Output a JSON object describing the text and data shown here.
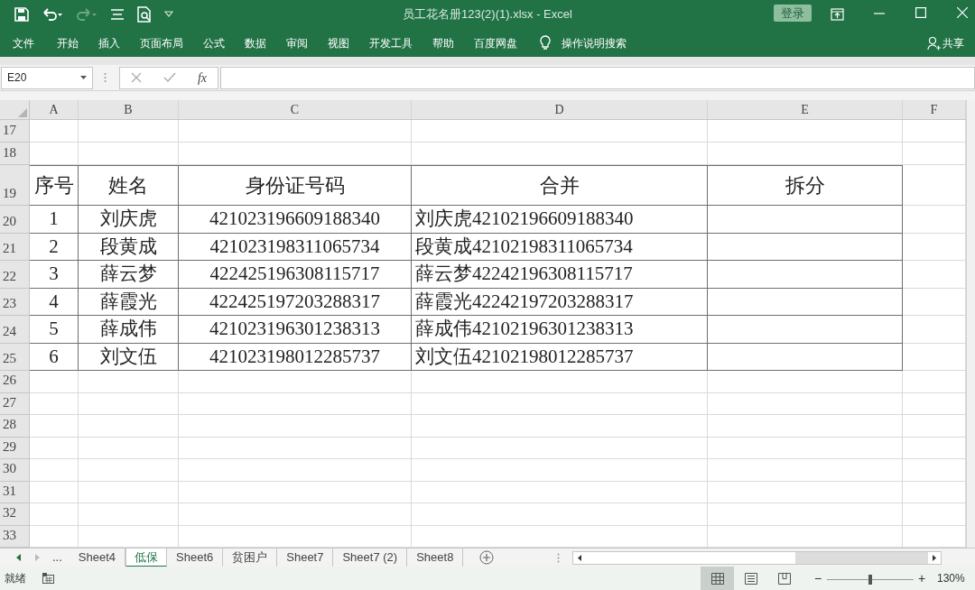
{
  "window": {
    "title": "员工花名册123(2)(1).xlsx  -  Excel",
    "login": "登录"
  },
  "ribbon": {
    "tabs": [
      "文件",
      "开始",
      "插入",
      "页面布局",
      "公式",
      "数据",
      "审阅",
      "视图",
      "开发工具",
      "帮助",
      "百度网盘"
    ],
    "search": "操作说明搜索",
    "share": "共享"
  },
  "formula_bar": {
    "name_box": "E20",
    "fx": "fx"
  },
  "sheet": {
    "columns": [
      "A",
      "B",
      "C",
      "D",
      "E",
      "F"
    ],
    "rows": [
      {
        "number": "17",
        "kind": "blank",
        "cells": []
      },
      {
        "number": "18",
        "kind": "blank",
        "cells": []
      },
      {
        "number": "19",
        "kind": "title",
        "cells": [
          "序号",
          "姓名",
          "身份证号码",
          "合并",
          "拆分"
        ]
      },
      {
        "number": "20",
        "kind": "data",
        "cells": [
          "1",
          "刘庆虎",
          "421023196609188340",
          "刘庆虎42102196609188340"
        ]
      },
      {
        "number": "21",
        "kind": "data",
        "cells": [
          "2",
          "段黄成",
          "421023198311065734",
          "段黄成42102198311065734"
        ]
      },
      {
        "number": "22",
        "kind": "data",
        "cells": [
          "3",
          "薛云梦",
          "422425196308115717",
          "薛云梦42242196308115717"
        ]
      },
      {
        "number": "23",
        "kind": "data",
        "cells": [
          "4",
          "薛霞光",
          "422425197203288317",
          "薛霞光42242197203288317"
        ]
      },
      {
        "number": "24",
        "kind": "data",
        "cells": [
          "5",
          "薛成伟",
          "421023196301238313",
          "薛成伟42102196301238313"
        ]
      },
      {
        "number": "25",
        "kind": "data",
        "cells": [
          "6",
          "刘文伍",
          "421023198012285737",
          "刘文伍42102198012285737"
        ]
      },
      {
        "number": "26",
        "kind": "blank",
        "cells": []
      },
      {
        "number": "27",
        "kind": "blank",
        "cells": []
      },
      {
        "number": "28",
        "kind": "blank",
        "cells": []
      },
      {
        "number": "29",
        "kind": "blank",
        "cells": []
      },
      {
        "number": "30",
        "kind": "blank",
        "cells": []
      },
      {
        "number": "31",
        "kind": "blank",
        "cells": []
      },
      {
        "number": "32",
        "kind": "blank",
        "cells": []
      },
      {
        "number": "33",
        "kind": "blank",
        "cells": []
      }
    ]
  },
  "sheet_tabs": {
    "more": "...",
    "tabs": [
      {
        "label": "Sheet4",
        "selected": false
      },
      {
        "label": "低保",
        "selected": true
      },
      {
        "label": "Sheet6",
        "selected": false
      },
      {
        "label": "贫困户",
        "selected": false
      },
      {
        "label": "Sheet7",
        "selected": false
      },
      {
        "label": "Sheet7 (2)",
        "selected": false
      },
      {
        "label": "Sheet8",
        "selected": false
      }
    ]
  },
  "status_bar": {
    "status": "就绪",
    "views": [
      {
        "kind": "normal",
        "selected": true
      },
      {
        "kind": "page-layout",
        "selected": false
      },
      {
        "kind": "page-break",
        "selected": false
      }
    ],
    "zoom_minus": "−",
    "zoom_plus": "+",
    "zoom": {
      "level": 0.5
    },
    "zoom_text": "130%"
  }
}
